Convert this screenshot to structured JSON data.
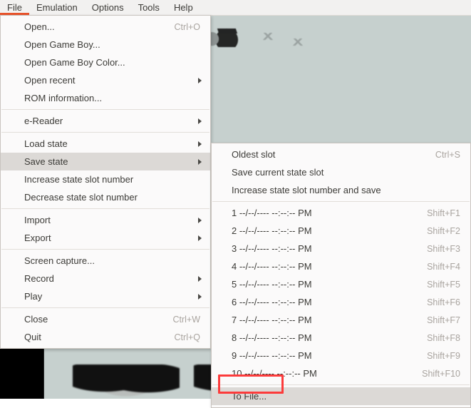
{
  "menubar": {
    "items": [
      {
        "label": "File",
        "open": true
      },
      {
        "label": "Emulation",
        "open": false
      },
      {
        "label": "Options",
        "open": false
      },
      {
        "label": "Tools",
        "open": false
      },
      {
        "label": "Help",
        "open": false
      }
    ]
  },
  "file_menu": {
    "rows": [
      {
        "label": "Open...",
        "accel": "Ctrl+O",
        "arrow": false,
        "selected": false
      },
      {
        "label": "Open Game Boy...",
        "accel": "",
        "arrow": false,
        "selected": false
      },
      {
        "label": "Open Game Boy Color...",
        "accel": "",
        "arrow": false,
        "selected": false
      },
      {
        "label": "Open recent",
        "accel": "",
        "arrow": true,
        "selected": false
      },
      {
        "label": "ROM information...",
        "accel": "",
        "arrow": false,
        "selected": false
      },
      {
        "separator": true
      },
      {
        "label": "e-Reader",
        "accel": "",
        "arrow": true,
        "selected": false
      },
      {
        "separator": true
      },
      {
        "label": "Load state",
        "accel": "",
        "arrow": true,
        "selected": false
      },
      {
        "label": "Save state",
        "accel": "",
        "arrow": true,
        "selected": true
      },
      {
        "label": "Increase state slot number",
        "accel": "",
        "arrow": false,
        "selected": false
      },
      {
        "label": "Decrease state slot number",
        "accel": "",
        "arrow": false,
        "selected": false
      },
      {
        "separator": true
      },
      {
        "label": "Import",
        "accel": "",
        "arrow": true,
        "selected": false
      },
      {
        "label": "Export",
        "accel": "",
        "arrow": true,
        "selected": false
      },
      {
        "separator": true
      },
      {
        "label": "Screen capture...",
        "accel": "",
        "arrow": false,
        "selected": false
      },
      {
        "label": "Record",
        "accel": "",
        "arrow": true,
        "selected": false
      },
      {
        "label": "Play",
        "accel": "",
        "arrow": true,
        "selected": false
      },
      {
        "separator": true
      },
      {
        "label": "Close",
        "accel": "Ctrl+W",
        "arrow": false,
        "selected": false
      },
      {
        "label": "Quit",
        "accel": "Ctrl+Q",
        "arrow": false,
        "selected": false
      }
    ]
  },
  "savestate_menu": {
    "rows": [
      {
        "label": "Oldest slot",
        "accel": "Ctrl+S",
        "selected": false
      },
      {
        "label": "Save current state slot",
        "accel": "",
        "selected": false
      },
      {
        "label": "Increase state slot number and save",
        "accel": "",
        "selected": false
      },
      {
        "separator": true
      },
      {
        "label": "1 --/--/---- --:--:-- PM",
        "accel": "Shift+F1",
        "selected": false
      },
      {
        "label": "2 --/--/---- --:--:-- PM",
        "accel": "Shift+F2",
        "selected": false
      },
      {
        "label": "3 --/--/---- --:--:-- PM",
        "accel": "Shift+F3",
        "selected": false
      },
      {
        "label": "4 --/--/---- --:--:-- PM",
        "accel": "Shift+F4",
        "selected": false
      },
      {
        "label": "5 --/--/---- --:--:-- PM",
        "accel": "Shift+F5",
        "selected": false
      },
      {
        "label": "6 --/--/---- --:--:-- PM",
        "accel": "Shift+F6",
        "selected": false
      },
      {
        "label": "7 --/--/---- --:--:-- PM",
        "accel": "Shift+F7",
        "selected": false
      },
      {
        "label": "8 --/--/---- --:--:-- PM",
        "accel": "Shift+F8",
        "selected": false
      },
      {
        "label": "9 --/--/---- --:--:-- PM",
        "accel": "Shift+F9",
        "selected": false
      },
      {
        "label": "10 --/--/---- --:--:-- PM",
        "accel": "Shift+F10",
        "selected": false
      },
      {
        "separator": true
      },
      {
        "label": "To File...",
        "accel": "",
        "selected": true
      }
    ]
  },
  "colors": {
    "accent": "#e8532b",
    "menu_bg": "#fbfafa",
    "menubar_bg": "#f2f1f0",
    "highlight": "#dcd9d6",
    "accel_text": "#a9a49f",
    "text": "#3c3b37",
    "annotation": "#fc3b3b",
    "game_bg": "#c6d0ce",
    "letterbox": "#000000"
  }
}
